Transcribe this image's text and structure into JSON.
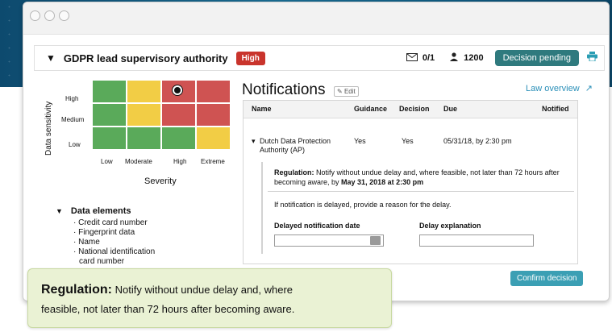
{
  "colors": {
    "accent": "#2f7a7e",
    "link": "#2a8fb8",
    "high": "#c9342c",
    "green": "#5aaa5a",
    "yellow": "#f2cd45",
    "red": "#cf5352",
    "callout_bg": "#eaf2d4"
  },
  "header": {
    "title": "GDPR lead supervisory authority",
    "risk_badge": "High",
    "messages": "0/1",
    "users": "1200",
    "decision_status": "Decision pending"
  },
  "risk_matrix": {
    "y_axis_label": "Data sensitivity",
    "y_levels": [
      "High",
      "Medium",
      "Low"
    ],
    "x_levels": [
      "Low",
      "Moderate",
      "High",
      "Extreme"
    ],
    "x_axis_label": "Severity",
    "grid": [
      [
        "g",
        "y",
        "r",
        "r"
      ],
      [
        "g",
        "y",
        "r",
        "r"
      ],
      [
        "g",
        "g",
        "g",
        "y"
      ]
    ],
    "marker": {
      "sensitivity": "High",
      "severity": "High"
    }
  },
  "data_elements": {
    "title": "Data elements",
    "items": [
      "Credit card number",
      "Fingerprint data",
      "Name",
      "National identification",
      "card number"
    ]
  },
  "notifications": {
    "title": "Notifications",
    "edit_label": "Edit",
    "law_link": "Law overview",
    "columns": [
      "Name",
      "Guidance",
      "Decision",
      "Due",
      "Notified"
    ],
    "row": {
      "name_line1": "Dutch Data Protection",
      "name_line2": "Authority (AP)",
      "guidance": "Yes",
      "decision": "Yes",
      "due": "05/31/18, by 2:30 pm",
      "notified": ""
    },
    "regulation_label": "Regulation:",
    "regulation_text": " Notify without undue delay and, where feasible, not later than 72 hours after becoming aware, by ",
    "regulation_deadline": "May 31, 2018 at 2:30 pm",
    "delay_prompt": "If notification is delayed, provide a reason for the delay.",
    "delayed_date_label": "Delayed notification date",
    "delay_explanation_label": "Delay explanation",
    "confirm_label": "Confirm decision"
  },
  "callout": {
    "title": "Regulation:",
    "text_line1": "Notify without undue delay and, where",
    "text_line2": "feasible, not later than 72 hours after becoming aware."
  }
}
